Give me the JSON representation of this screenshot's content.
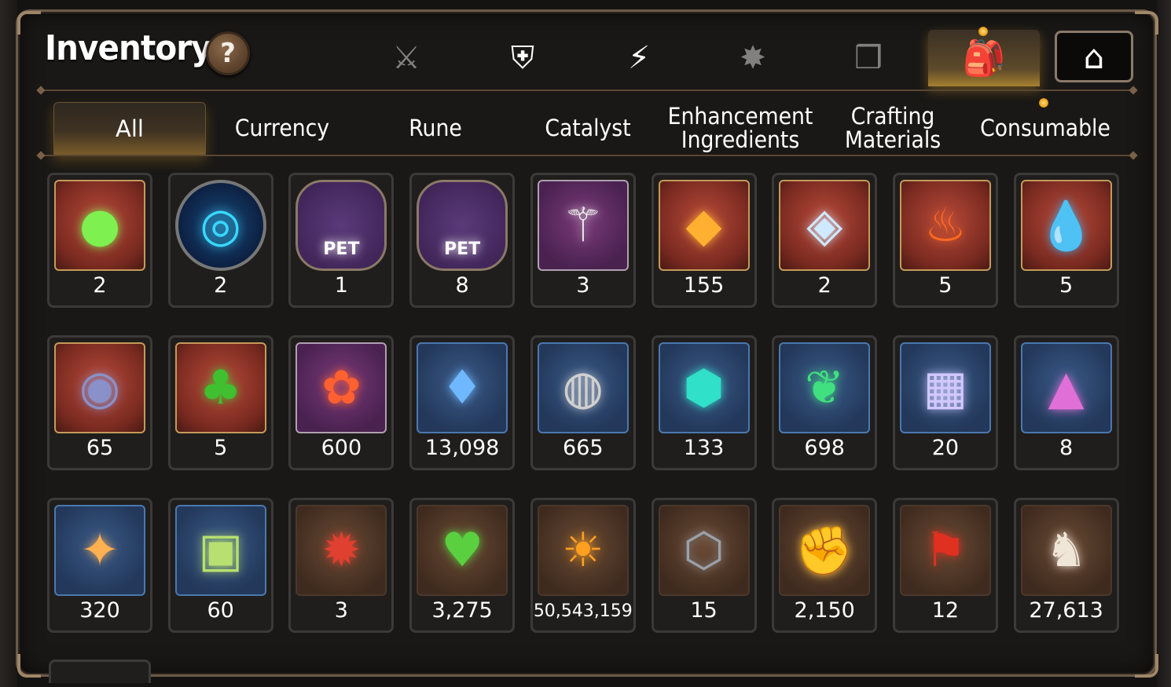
{
  "header": {
    "title": "Inventory",
    "help_label": "?"
  },
  "category_tabs": [
    {
      "name": "equipment-icon",
      "glyph": "⚔"
    },
    {
      "name": "disabled-gear-icon",
      "glyph": "⛨"
    },
    {
      "name": "lightning-icon",
      "glyph": "⚡"
    },
    {
      "name": "burst-icon",
      "glyph": "✸"
    },
    {
      "name": "cube-icon",
      "glyph": "❒"
    },
    {
      "name": "backpack-icon",
      "glyph": "🎒"
    },
    {
      "name": "guild-house-icon",
      "glyph": "⌂"
    }
  ],
  "sub_tabs": [
    {
      "label": "All"
    },
    {
      "label": "Currency"
    },
    {
      "label": "Rune"
    },
    {
      "label": "Catalyst"
    },
    {
      "label": "Enhancement\nIngredients"
    },
    {
      "label": "Crafting\nMaterials"
    },
    {
      "label": "Consumable"
    }
  ],
  "items": [
    {
      "name": "green-gem-item",
      "glyph": "●",
      "frame": "fr-red",
      "color": "#7ef050",
      "count": "2"
    },
    {
      "name": "blue-rune-orb-item",
      "glyph": "◎",
      "frame": "fr-round",
      "color": "#38d8ff",
      "count": "2"
    },
    {
      "name": "pet-bag-item",
      "glyph": "PET",
      "frame": "fr-hex",
      "color": "#ffffff",
      "count": "1"
    },
    {
      "name": "pet-bag-item",
      "glyph": "PET",
      "frame": "fr-hex",
      "color": "#ffffff",
      "count": "8"
    },
    {
      "name": "feather-wand-item",
      "glyph": "⚚",
      "frame": "fr-purple",
      "color": "#e8e8e8",
      "count": "3"
    },
    {
      "name": "golden-crystal-item",
      "glyph": "◆",
      "frame": "fr-red",
      "color": "#ffb030",
      "count": "155"
    },
    {
      "name": "tetra-crystal-item",
      "glyph": "◈",
      "frame": "fr-red",
      "color": "#cfeaff",
      "count": "2"
    },
    {
      "name": "fire-pendant-item",
      "glyph": "♨",
      "frame": "fr-red",
      "color": "#ff6a20",
      "count": "5"
    },
    {
      "name": "water-pendant-item",
      "glyph": "💧",
      "frame": "fr-red",
      "color": "#40a8e0",
      "count": "5"
    },
    {
      "name": "ring-pendant-item",
      "glyph": "◉",
      "frame": "fr-red",
      "color": "#8a90c8",
      "count": "65"
    },
    {
      "name": "clover-pendant-item",
      "glyph": "♣",
      "frame": "fr-red",
      "color": "#40c030",
      "count": "5"
    },
    {
      "name": "flower-ring-item",
      "glyph": "✿",
      "frame": "fr-purple",
      "color": "#ff6030",
      "count": "600"
    },
    {
      "name": "blue-gem-item",
      "glyph": "♦",
      "frame": "fr-blue",
      "color": "#6fb8ff",
      "count": "13,098"
    },
    {
      "name": "silver-coin-item",
      "glyph": "◍",
      "frame": "fr-blue",
      "color": "#cfcfcf",
      "count": "665"
    },
    {
      "name": "cyan-crystal-item",
      "glyph": "⬢",
      "frame": "fr-blue",
      "color": "#30e0c8",
      "count": "133"
    },
    {
      "name": "leaf-item",
      "glyph": "❦",
      "frame": "fr-blue",
      "color": "#40e080",
      "count": "698"
    },
    {
      "name": "pet-card-item",
      "glyph": "▦",
      "frame": "fr-blue",
      "color": "#d0c8ff",
      "count": "20"
    },
    {
      "name": "pink-crystal-item",
      "glyph": "▲",
      "frame": "fr-blue",
      "color": "#e070d8",
      "count": "8"
    },
    {
      "name": "star-pendant-item",
      "glyph": "✦",
      "frame": "fr-blue",
      "color": "#ffb050",
      "count": "320"
    },
    {
      "name": "costume-card-item",
      "glyph": "▣",
      "frame": "fr-blue",
      "color": "#b8e070",
      "count": "60"
    },
    {
      "name": "red-badge-item",
      "glyph": "✹",
      "frame": "fr-brown",
      "color": "#e04030",
      "count": "3"
    },
    {
      "name": "green-heart-item",
      "glyph": "♥",
      "frame": "fr-brown",
      "color": "#5ad040",
      "count": "3,275"
    },
    {
      "name": "gold-coin-item",
      "glyph": "☀",
      "frame": "fr-brown",
      "color": "#ffa020",
      "count": "50,543,159",
      "small": true
    },
    {
      "name": "compass-stone-item",
      "glyph": "⬡",
      "frame": "fr-brown",
      "color": "#9aa0a8",
      "count": "15"
    },
    {
      "name": "fist-emblem-item",
      "glyph": "✊",
      "frame": "fr-brown",
      "color": "#ffc040",
      "count": "2,150"
    },
    {
      "name": "red-banner-item",
      "glyph": "⚑",
      "frame": "fr-brown",
      "color": "#e03020",
      "count": "12"
    },
    {
      "name": "chess-knight-item",
      "glyph": "♞",
      "frame": "fr-brown",
      "color": "#f0e6d8",
      "count": "27,613"
    }
  ]
}
